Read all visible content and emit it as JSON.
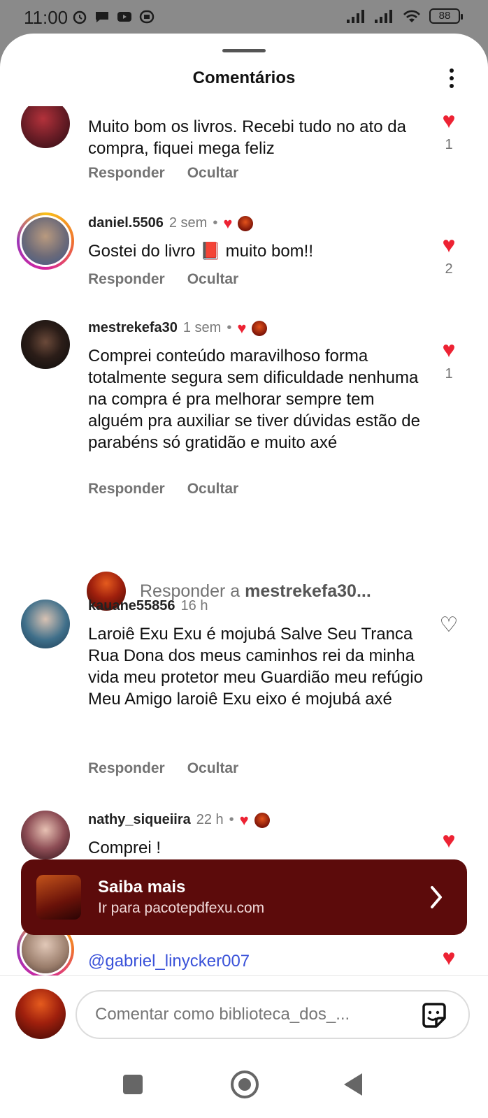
{
  "status_bar": {
    "time": "11:00",
    "battery": "88"
  },
  "header": {
    "title": "Comentários"
  },
  "colors": {
    "like": "#ed2233",
    "banner_bg": "#5c0b0b",
    "mention": "#3a52d9",
    "muted": "#737373"
  },
  "comments": [
    {
      "username": "",
      "time": "",
      "text": "Muito bom os livros. Recebi tudo no ato da compra, fiquei mega feliz",
      "liked": true,
      "likes": "1",
      "reply_label": "Responder",
      "hide_label": "Ocultar"
    },
    {
      "username": "daniel.5506",
      "time": "2 sem",
      "text": "Gostei do livro 📕 muito bom!!",
      "liked": true,
      "likes": "2",
      "reply_label": "Responder",
      "hide_label": "Ocultar"
    },
    {
      "username": "mestrekefa30",
      "time": "1 sem",
      "text": "Comprei conteúdo maravilhoso forma totalmente segura sem dificuldade nenhuma na compra é pra melhorar sempre tem alguém pra auxiliar se tiver dúvidas estão de parabéns só gratidão e muito axé",
      "liked": true,
      "likes": "1",
      "reply_label": "Responder",
      "hide_label": "Ocultar"
    },
    {
      "username": "kauane55856",
      "time": "16 h",
      "text": "Laroiê Exu Exu é mojubá Salve Seu Tranca Rua Dona dos meus caminhos rei da minha vida meu protetor meu Guardião meu refúgio Meu Amigo laroiê Exu eixo é mojubá axé",
      "liked": false,
      "likes": "",
      "reply_label": "Responder",
      "hide_label": "Ocultar"
    },
    {
      "username": "nathy_siqueiira",
      "time": "22 h",
      "text": "Comprei !",
      "liked": true,
      "likes": "",
      "reply_label": "",
      "hide_label": ""
    },
    {
      "username": "",
      "time": "",
      "text": "@gabriel_linycker007",
      "liked": true,
      "likes": "",
      "reply_label": "",
      "hide_label": ""
    }
  ],
  "reply_prompt": {
    "prefix": "Responder a ",
    "username": "mestrekefa30..."
  },
  "banner": {
    "title": "Saiba mais",
    "subtitle": "Ir para pacotepdfexu.com",
    "icon": "chevron-right-icon"
  },
  "composer": {
    "placeholder": "Comentar como biblioteca_dos_...",
    "sticker_icon": "sticker-icon"
  },
  "nav": {
    "recents_icon": "square-icon",
    "home_icon": "circle-icon",
    "back_icon": "triangle-back-icon"
  }
}
